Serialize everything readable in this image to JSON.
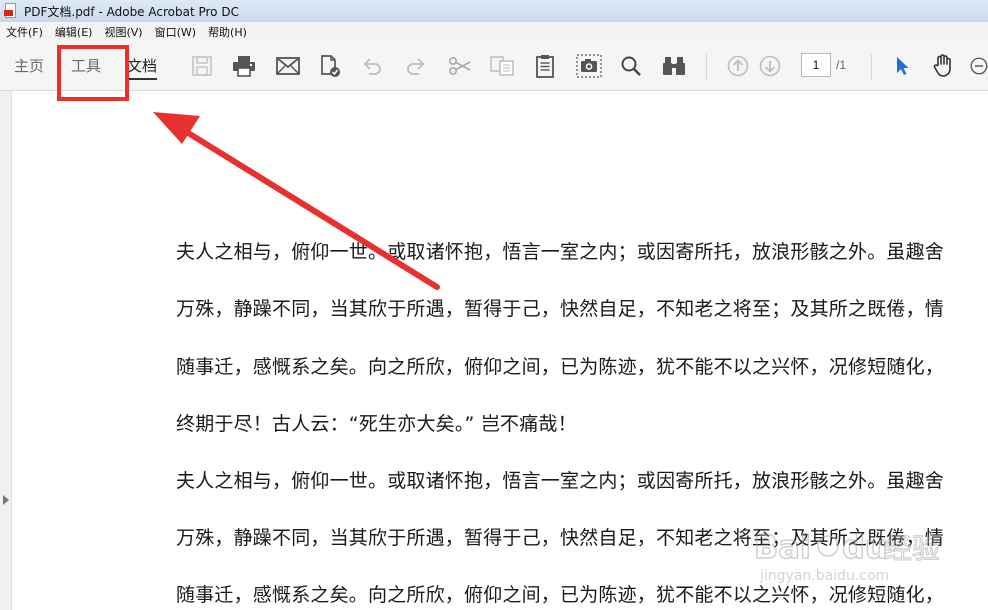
{
  "window": {
    "title": "PDF文档.pdf - Adobe Acrobat Pro DC"
  },
  "menu": {
    "items": [
      "文件(F)",
      "编辑(E)",
      "视图(V)",
      "窗口(W)",
      "帮助(H)"
    ]
  },
  "nav_tabs": [
    "主页",
    "工具",
    "文档"
  ],
  "active_tab": "文档",
  "toolbar_icons": [
    "save-icon",
    "print-icon",
    "email-icon",
    "sign-icon",
    "undo-icon",
    "redo-icon",
    "cut-icon",
    "copy-icon",
    "clipboard-icon",
    "snapshot-icon",
    "search-icon",
    "find-binoculars-icon",
    "page-up-icon",
    "page-down-icon",
    "select-cursor-icon",
    "hand-tool-icon",
    "zoom-out-icon"
  ],
  "pagination": {
    "current": "1",
    "total": "/1"
  },
  "document": {
    "lines": [
      "夫人之相与，俯仰一世。或取诸怀抱，悟言一室之内；或因寄所托，放浪形骸之外。虽趣舍",
      "万殊，静躁不同，当其欣于所遇，暂得于己，快然自足，不知老之将至；及其所之既倦，情",
      "随事迁，感慨系之矣。向之所欣，俯仰之间，已为陈迹，犹不能不以之兴怀，况修短随化，",
      "终期于尽！古人云：“死生亦大矣。” 岂不痛哉！",
      "夫人之相与，俯仰一世。或取诸怀抱，悟言一室之内；或因寄所托，放浪形骸之外。虽趣舍",
      "万殊，静躁不同，当其欣于所遇，暂得于己，快然自足，不知老之将至；及其所之既倦，情",
      "随事迁，感慨系之矣。向之所欣，俯仰之间，已为陈迹，犹不能不以之兴怀，况修短随化，"
    ]
  },
  "annotation": {
    "color": "#e8302e",
    "highlighted_tab": "工具"
  },
  "watermark": {
    "brand": "Baidu经验",
    "url": "jingyan.baidu.com"
  }
}
